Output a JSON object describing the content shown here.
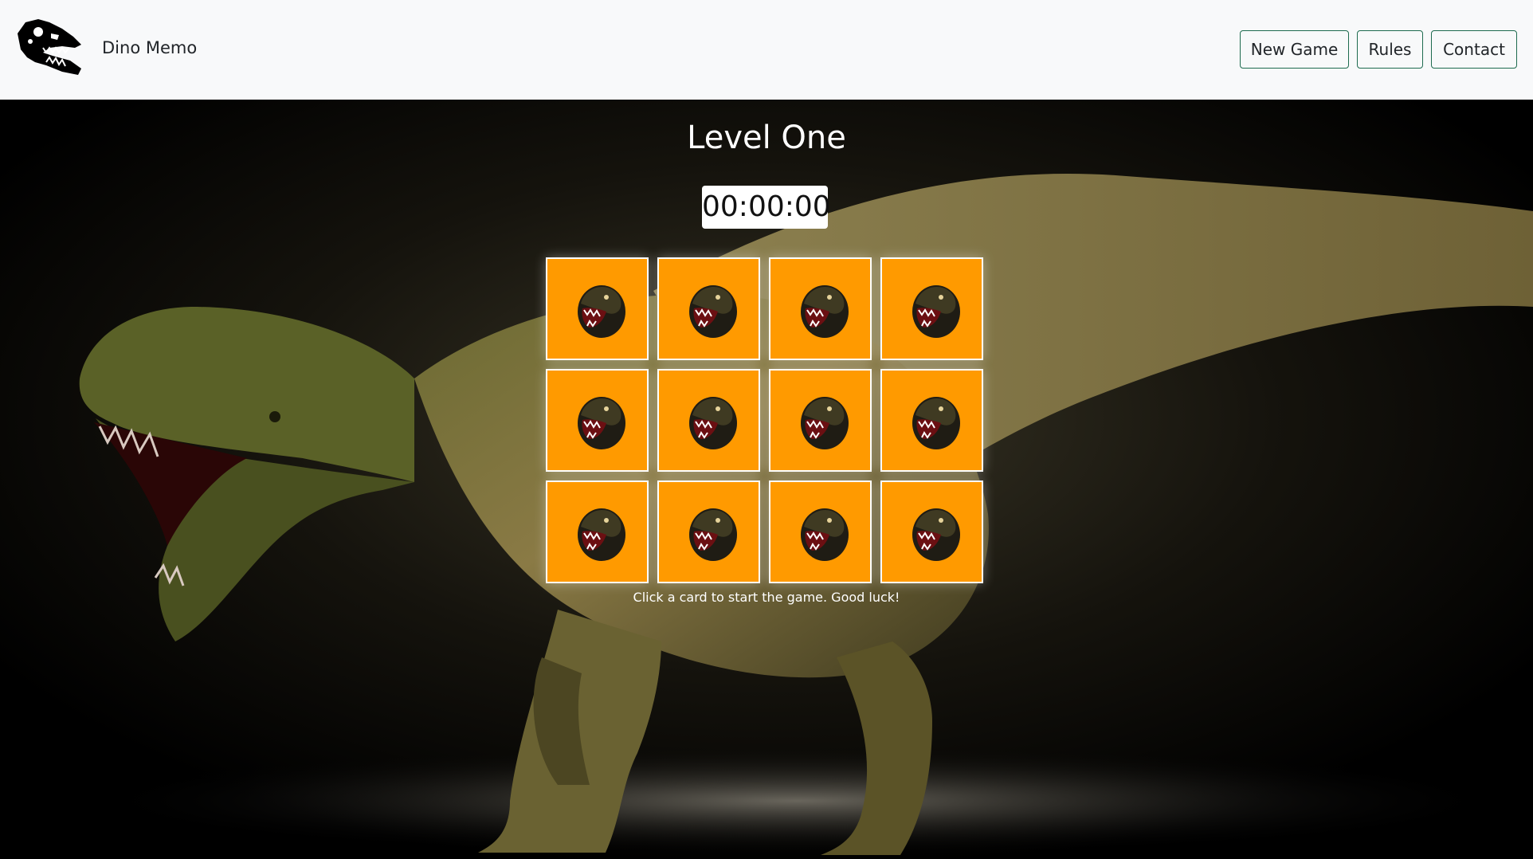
{
  "header": {
    "brand_title": "Dino Memo",
    "logo_icon": "dino-skull-icon",
    "nav": {
      "new_game_label": "New Game",
      "rules_label": "Rules",
      "contact_label": "Contact"
    },
    "accent_color": "#1e6b4f"
  },
  "game": {
    "level_title": "Level One",
    "timer": "00:00:00",
    "hint": "Click a card to start the game. Good luck!",
    "card_back_color": "#ff9a00",
    "card_back_icon": "trex-head-icon",
    "cards": [
      {
        "state": "face-down"
      },
      {
        "state": "face-down"
      },
      {
        "state": "face-down"
      },
      {
        "state": "face-down"
      },
      {
        "state": "face-down"
      },
      {
        "state": "face-down"
      },
      {
        "state": "face-down"
      },
      {
        "state": "face-down"
      },
      {
        "state": "face-down"
      },
      {
        "state": "face-down"
      },
      {
        "state": "face-down"
      },
      {
        "state": "face-down"
      }
    ],
    "background_image": "t-rex-illustration"
  }
}
